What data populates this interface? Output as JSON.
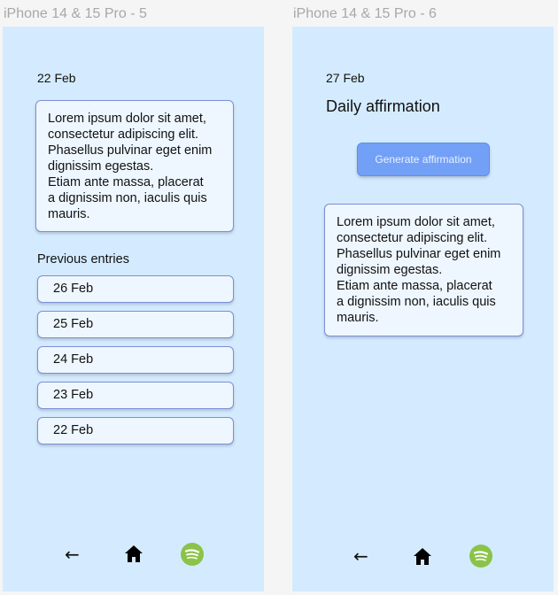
{
  "frames": [
    {
      "label": "iPhone 14 & 15 Pro - 5",
      "date": "22 Feb",
      "entry_text": "Lorem ipsum dolor sit amet,\nconsectetur adipiscing elit.\nPhasellus pulvinar eget enim\ndignissim egestas.\nEtiam ante massa, placerat\na dignissim non, iaculis quis\nmauris.",
      "previous_label": "Previous entries",
      "entries": [
        "26 Feb",
        "25 Feb",
        "24 Feb",
        "23 Feb",
        "22 Feb"
      ],
      "nav": {
        "back": "←",
        "icons": [
          "back-arrow-icon",
          "home-icon",
          "spotify-icon"
        ]
      }
    },
    {
      "label": "iPhone 14 & 15 Pro - 6",
      "date": "27 Feb",
      "title": "Daily affirmation",
      "button_label": "Generate affirmation",
      "affirmation_text": "Lorem ipsum dolor sit amet,\nconsectetur adipiscing elit.\nPhasellus pulvinar eget enim\ndignissim egestas.\nEtiam ante massa, placerat\na dignissim non, iaculis quis\nmauris.",
      "nav": {
        "back": "←",
        "icons": [
          "back-arrow-icon",
          "home-icon",
          "spotify-icon"
        ]
      }
    }
  ],
  "colors": {
    "frame_bg": "#d4ebff",
    "card_bg": "#eef7ff",
    "card_border": "#7c8fd6",
    "button_bg": "#72a0f7",
    "spotify_green": "#8bc34a"
  }
}
